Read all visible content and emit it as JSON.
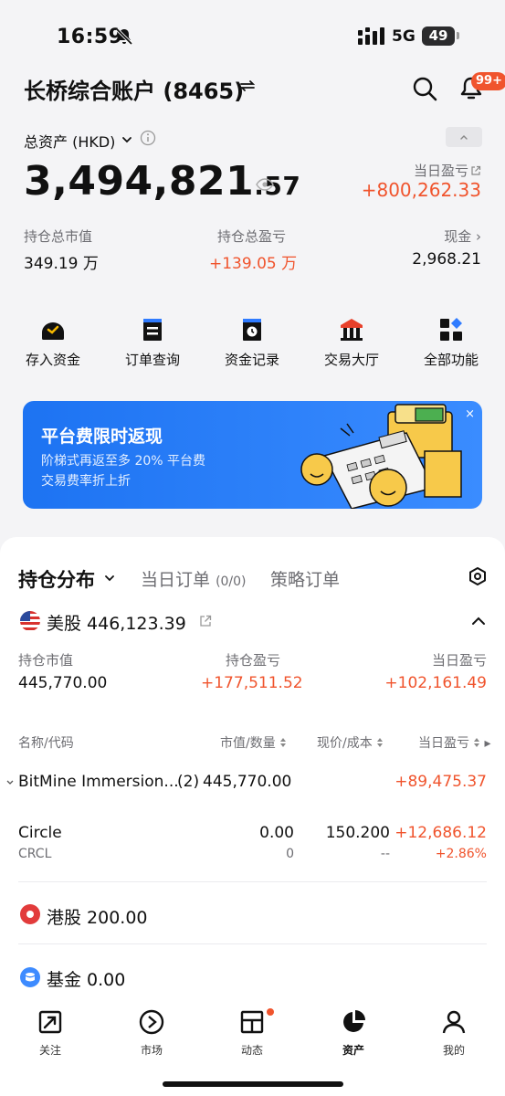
{
  "status_bar": {
    "time": "16:59",
    "network": "5G",
    "battery": "49"
  },
  "header": {
    "title": "长桥综合账户 (8465)",
    "notification_badge": "99+"
  },
  "assets": {
    "label": "总资产 (HKD)",
    "total_int": "3,494,821",
    "total_dec": ".57",
    "day_pl_label": "当日盈亏",
    "day_pl_value": "+800,262.33",
    "stats": [
      {
        "label": "持仓总市值",
        "value": "349.19 万"
      },
      {
        "label": "持仓总盈亏",
        "value": "+139.05 万"
      },
      {
        "label": "现金",
        "value": "2,968.21"
      }
    ]
  },
  "shortcuts": [
    {
      "label": "存入资金",
      "icon": "deposit-icon"
    },
    {
      "label": "订单查询",
      "icon": "order-query-icon"
    },
    {
      "label": "资金记录",
      "icon": "fund-record-icon"
    },
    {
      "label": "交易大厅",
      "icon": "trading-hall-icon"
    },
    {
      "label": "全部功能",
      "icon": "all-functions-icon"
    }
  ],
  "banner": {
    "title": "平台费限时返现",
    "line1": "阶梯式再返至多 20% 平台费",
    "line2": "交易费率折上折",
    "close": "×"
  },
  "holdings": {
    "tabs": [
      {
        "label": "持仓分布"
      },
      {
        "label": "当日订单",
        "count": "(0/0)"
      },
      {
        "label": "策略订单"
      }
    ],
    "us": {
      "title": "美股 446,123.39",
      "market_value_label": "持仓市值",
      "market_value": "445,770.00",
      "pl_label": "持仓盈亏",
      "pl_value": "+177,511.52",
      "day_pl_label": "当日盈亏",
      "day_pl_value": "+102,161.49"
    },
    "columns": [
      "名称/代码",
      "市值/数量",
      "现价/成本",
      "当日盈亏"
    ],
    "rows": [
      {
        "name": "BitMine Immersion...",
        "count": "(2)",
        "market_value": "445,770.00",
        "day_pl": "+89,475.37"
      },
      {
        "name": "Circle",
        "code": "CRCL",
        "market_value": "0.00",
        "quantity": "0",
        "price": "150.200",
        "cost": "--",
        "day_pl": "+12,686.12",
        "day_pl_pct": "+2.86%"
      }
    ],
    "hk": {
      "title": "港股 200.00"
    },
    "fund": {
      "title": "基金 0.00"
    }
  },
  "nav": [
    {
      "label": "关注",
      "icon": "watchlist-icon"
    },
    {
      "label": "市场",
      "icon": "market-icon"
    },
    {
      "label": "动态",
      "icon": "feed-icon"
    },
    {
      "label": "资产",
      "icon": "assets-icon"
    },
    {
      "label": "我的",
      "icon": "profile-icon"
    }
  ],
  "colors": {
    "accent": "#f0542d",
    "banner_blue": "#1d73f2",
    "muted": "#6d6d72"
  }
}
